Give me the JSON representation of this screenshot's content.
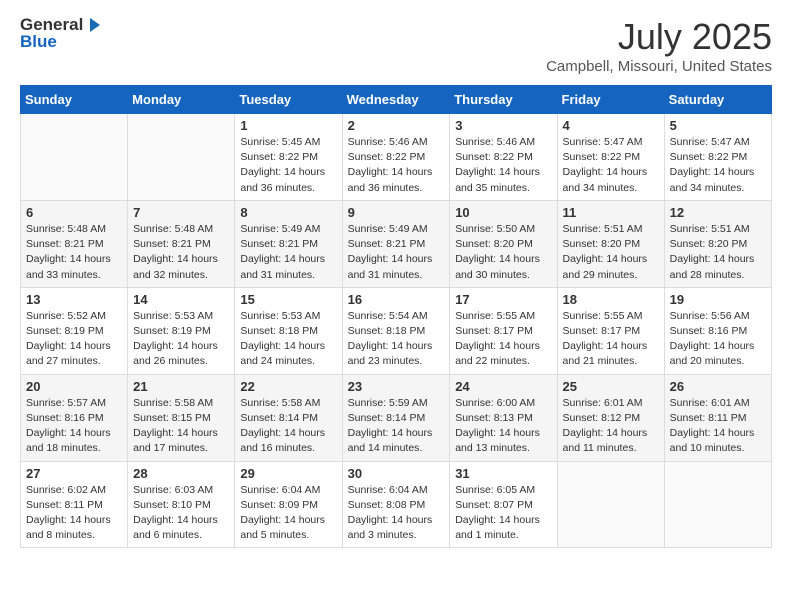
{
  "logo": {
    "general": "General",
    "blue": "Blue"
  },
  "title": "July 2025",
  "subtitle": "Campbell, Missouri, United States",
  "days_of_week": [
    "Sunday",
    "Monday",
    "Tuesday",
    "Wednesday",
    "Thursday",
    "Friday",
    "Saturday"
  ],
  "weeks": [
    [
      {
        "day": "",
        "sunrise": "",
        "sunset": "",
        "daylight": ""
      },
      {
        "day": "",
        "sunrise": "",
        "sunset": "",
        "daylight": ""
      },
      {
        "day": "1",
        "sunrise": "Sunrise: 5:45 AM",
        "sunset": "Sunset: 8:22 PM",
        "daylight": "Daylight: 14 hours and 36 minutes."
      },
      {
        "day": "2",
        "sunrise": "Sunrise: 5:46 AM",
        "sunset": "Sunset: 8:22 PM",
        "daylight": "Daylight: 14 hours and 36 minutes."
      },
      {
        "day": "3",
        "sunrise": "Sunrise: 5:46 AM",
        "sunset": "Sunset: 8:22 PM",
        "daylight": "Daylight: 14 hours and 35 minutes."
      },
      {
        "day": "4",
        "sunrise": "Sunrise: 5:47 AM",
        "sunset": "Sunset: 8:22 PM",
        "daylight": "Daylight: 14 hours and 34 minutes."
      },
      {
        "day": "5",
        "sunrise": "Sunrise: 5:47 AM",
        "sunset": "Sunset: 8:22 PM",
        "daylight": "Daylight: 14 hours and 34 minutes."
      }
    ],
    [
      {
        "day": "6",
        "sunrise": "Sunrise: 5:48 AM",
        "sunset": "Sunset: 8:21 PM",
        "daylight": "Daylight: 14 hours and 33 minutes."
      },
      {
        "day": "7",
        "sunrise": "Sunrise: 5:48 AM",
        "sunset": "Sunset: 8:21 PM",
        "daylight": "Daylight: 14 hours and 32 minutes."
      },
      {
        "day": "8",
        "sunrise": "Sunrise: 5:49 AM",
        "sunset": "Sunset: 8:21 PM",
        "daylight": "Daylight: 14 hours and 31 minutes."
      },
      {
        "day": "9",
        "sunrise": "Sunrise: 5:49 AM",
        "sunset": "Sunset: 8:21 PM",
        "daylight": "Daylight: 14 hours and 31 minutes."
      },
      {
        "day": "10",
        "sunrise": "Sunrise: 5:50 AM",
        "sunset": "Sunset: 8:20 PM",
        "daylight": "Daylight: 14 hours and 30 minutes."
      },
      {
        "day": "11",
        "sunrise": "Sunrise: 5:51 AM",
        "sunset": "Sunset: 8:20 PM",
        "daylight": "Daylight: 14 hours and 29 minutes."
      },
      {
        "day": "12",
        "sunrise": "Sunrise: 5:51 AM",
        "sunset": "Sunset: 8:20 PM",
        "daylight": "Daylight: 14 hours and 28 minutes."
      }
    ],
    [
      {
        "day": "13",
        "sunrise": "Sunrise: 5:52 AM",
        "sunset": "Sunset: 8:19 PM",
        "daylight": "Daylight: 14 hours and 27 minutes."
      },
      {
        "day": "14",
        "sunrise": "Sunrise: 5:53 AM",
        "sunset": "Sunset: 8:19 PM",
        "daylight": "Daylight: 14 hours and 26 minutes."
      },
      {
        "day": "15",
        "sunrise": "Sunrise: 5:53 AM",
        "sunset": "Sunset: 8:18 PM",
        "daylight": "Daylight: 14 hours and 24 minutes."
      },
      {
        "day": "16",
        "sunrise": "Sunrise: 5:54 AM",
        "sunset": "Sunset: 8:18 PM",
        "daylight": "Daylight: 14 hours and 23 minutes."
      },
      {
        "day": "17",
        "sunrise": "Sunrise: 5:55 AM",
        "sunset": "Sunset: 8:17 PM",
        "daylight": "Daylight: 14 hours and 22 minutes."
      },
      {
        "day": "18",
        "sunrise": "Sunrise: 5:55 AM",
        "sunset": "Sunset: 8:17 PM",
        "daylight": "Daylight: 14 hours and 21 minutes."
      },
      {
        "day": "19",
        "sunrise": "Sunrise: 5:56 AM",
        "sunset": "Sunset: 8:16 PM",
        "daylight": "Daylight: 14 hours and 20 minutes."
      }
    ],
    [
      {
        "day": "20",
        "sunrise": "Sunrise: 5:57 AM",
        "sunset": "Sunset: 8:16 PM",
        "daylight": "Daylight: 14 hours and 18 minutes."
      },
      {
        "day": "21",
        "sunrise": "Sunrise: 5:58 AM",
        "sunset": "Sunset: 8:15 PM",
        "daylight": "Daylight: 14 hours and 17 minutes."
      },
      {
        "day": "22",
        "sunrise": "Sunrise: 5:58 AM",
        "sunset": "Sunset: 8:14 PM",
        "daylight": "Daylight: 14 hours and 16 minutes."
      },
      {
        "day": "23",
        "sunrise": "Sunrise: 5:59 AM",
        "sunset": "Sunset: 8:14 PM",
        "daylight": "Daylight: 14 hours and 14 minutes."
      },
      {
        "day": "24",
        "sunrise": "Sunrise: 6:00 AM",
        "sunset": "Sunset: 8:13 PM",
        "daylight": "Daylight: 14 hours and 13 minutes."
      },
      {
        "day": "25",
        "sunrise": "Sunrise: 6:01 AM",
        "sunset": "Sunset: 8:12 PM",
        "daylight": "Daylight: 14 hours and 11 minutes."
      },
      {
        "day": "26",
        "sunrise": "Sunrise: 6:01 AM",
        "sunset": "Sunset: 8:11 PM",
        "daylight": "Daylight: 14 hours and 10 minutes."
      }
    ],
    [
      {
        "day": "27",
        "sunrise": "Sunrise: 6:02 AM",
        "sunset": "Sunset: 8:11 PM",
        "daylight": "Daylight: 14 hours and 8 minutes."
      },
      {
        "day": "28",
        "sunrise": "Sunrise: 6:03 AM",
        "sunset": "Sunset: 8:10 PM",
        "daylight": "Daylight: 14 hours and 6 minutes."
      },
      {
        "day": "29",
        "sunrise": "Sunrise: 6:04 AM",
        "sunset": "Sunset: 8:09 PM",
        "daylight": "Daylight: 14 hours and 5 minutes."
      },
      {
        "day": "30",
        "sunrise": "Sunrise: 6:04 AM",
        "sunset": "Sunset: 8:08 PM",
        "daylight": "Daylight: 14 hours and 3 minutes."
      },
      {
        "day": "31",
        "sunrise": "Sunrise: 6:05 AM",
        "sunset": "Sunset: 8:07 PM",
        "daylight": "Daylight: 14 hours and 1 minute."
      },
      {
        "day": "",
        "sunrise": "",
        "sunset": "",
        "daylight": ""
      },
      {
        "day": "",
        "sunrise": "",
        "sunset": "",
        "daylight": ""
      }
    ]
  ]
}
